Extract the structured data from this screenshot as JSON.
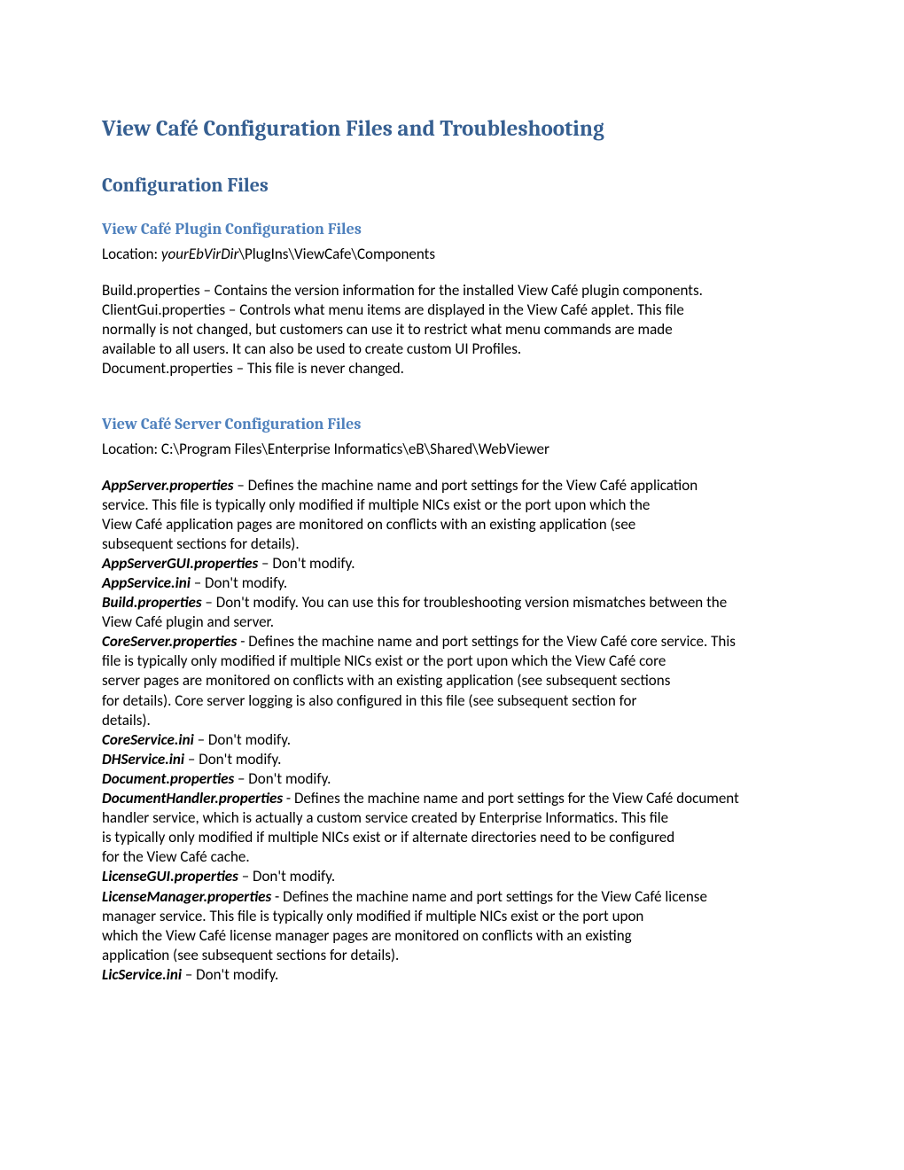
{
  "h1": "View Café Configuration Files and Troubleshooting",
  "h2": "Configuration Files",
  "plugin": {
    "heading": "View Café Plugin Configuration Files",
    "locationLabel": "Location: ",
    "locationItalic": "yourEbVirDir",
    "locationRest": "\\PlugIns\\ViewCafe\\Components",
    "entries": [
      {
        "name": "Build.properties",
        "desc": " – Contains the version information for the installed View Café plugin components.",
        "cont": []
      },
      {
        "name": "ClientGui.properties",
        "desc": " – Controls what menu items are displayed in the View Café applet.  This file",
        "cont": [
          "normally is not changed, but customers can use it to restrict what menu commands are made",
          "available to all users.  It can also be used to create custom UI Profiles."
        ]
      },
      {
        "name": "Document.properties",
        "desc": " – This file is never changed.",
        "cont": []
      }
    ]
  },
  "server": {
    "heading": "View Café Server Configuration Files",
    "locationLabel": "Location: ",
    "locationPath": "C:\\Program Files\\Enterprise Informatics\\eB\\Shared\\WebViewer",
    "entries": [
      {
        "name": "AppServer.properties",
        "desc": " – Defines the machine name and port settings for the View Café application",
        "cont": [
          "service.  This file is typically only modified if multiple NICs exist or the port upon which the",
          "View Café application pages are monitored on conflicts with an existing application (see",
          "subsequent sections for details)."
        ]
      },
      {
        "name": "AppServerGUI.properties",
        "desc": " – Don't modify.",
        "cont": []
      },
      {
        "name": "AppService.ini",
        "desc": " – Don't modify.",
        "cont": []
      },
      {
        "name": "Build.properties",
        "desc": " – Don't modify.  You can use this for troubleshooting version mismatches between the",
        "cont": [
          "View Café plugin and server."
        ]
      },
      {
        "name": "CoreServer.properties",
        "desc": " - Defines the machine name and port settings for the View Café core service.  This",
        "cont": [
          "file is typically only modified if multiple NICs exist or the port upon which the View Café core",
          "server pages are monitored on conflicts with an existing application (see subsequent sections",
          "for details).  Core server logging is also configured in this file (see subsequent section for",
          "details)."
        ]
      },
      {
        "name": "CoreService.ini",
        "desc": " – Don't modify.",
        "cont": []
      },
      {
        "name": "DHService.ini",
        "desc": " – Don't modify.",
        "cont": []
      },
      {
        "name": "Document.properties",
        "desc": " – Don't modify.",
        "cont": []
      },
      {
        "name": "DocumentHandler.properties",
        "desc": " - Defines the machine name and port settings for the View Café document",
        "cont": [
          "handler service, which is actually a custom service created by Enterprise Informatics.  This file",
          "is typically only modified if multiple NICs exist or if alternate directories need to be configured",
          "for the View Café cache."
        ]
      },
      {
        "name": "LicenseGUI.properties",
        "desc": " – Don't modify.",
        "cont": []
      },
      {
        "name": "LicenseManager.properties",
        "desc": " - Defines the machine name and port settings for the View Café license",
        "cont": [
          "manager service.  This file is typically only modified if multiple NICs exist or the port upon",
          "which the View Café license manager pages are monitored on conflicts with an existing",
          "application (see subsequent sections for details)."
        ]
      },
      {
        "name": "LicService.ini",
        "desc": " – Don't modify.",
        "cont": []
      }
    ]
  }
}
